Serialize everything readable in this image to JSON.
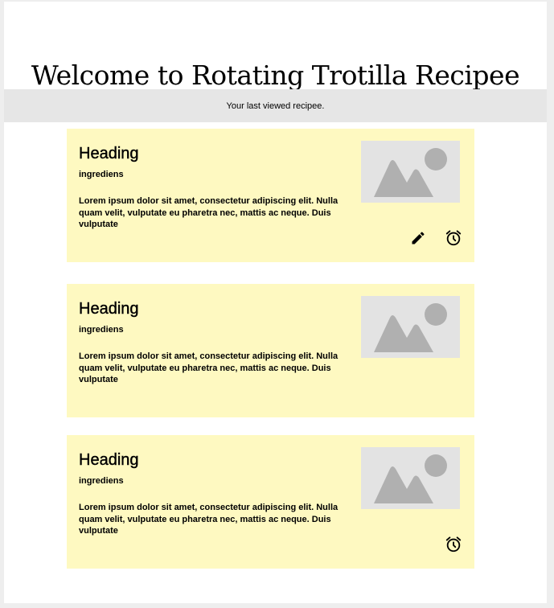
{
  "page": {
    "title": "Welcome to Rotating Trotilla Recipee",
    "banner": "Your last viewed recipee."
  },
  "cards": [
    {
      "heading": "Heading",
      "subheading": "ingrediens",
      "body": "Lorem ipsum dolor sit amet, consectetur adipiscing elit. Nulla quam velit, vulputate eu pharetra nec, mattis ac neque. Duis vulputate",
      "image": "image-placeholder-icon",
      "actions": [
        "pencil-icon",
        "alarm-clock-icon"
      ]
    },
    {
      "heading": "Heading",
      "subheading": "ingrediens",
      "body": "Lorem ipsum dolor sit amet, consectetur adipiscing elit. Nulla quam velit, vulputate eu pharetra nec, mattis ac neque. Duis vulputate",
      "image": "image-placeholder-icon",
      "actions": []
    },
    {
      "heading": "Heading",
      "subheading": "ingrediens",
      "body": "Lorem ipsum dolor sit amet, consectetur adipiscing elit. Nulla quam velit, vulputate eu pharetra nec, mattis ac neque. Duis vulputate",
      "image": "image-placeholder-icon",
      "actions": [
        "alarm-clock-icon"
      ]
    }
  ],
  "colors": {
    "card_background": "#fef9c1",
    "banner_background": "#e6e6e6",
    "placeholder_background": "#e3e3e3",
    "placeholder_shape": "#b0b0b0"
  }
}
